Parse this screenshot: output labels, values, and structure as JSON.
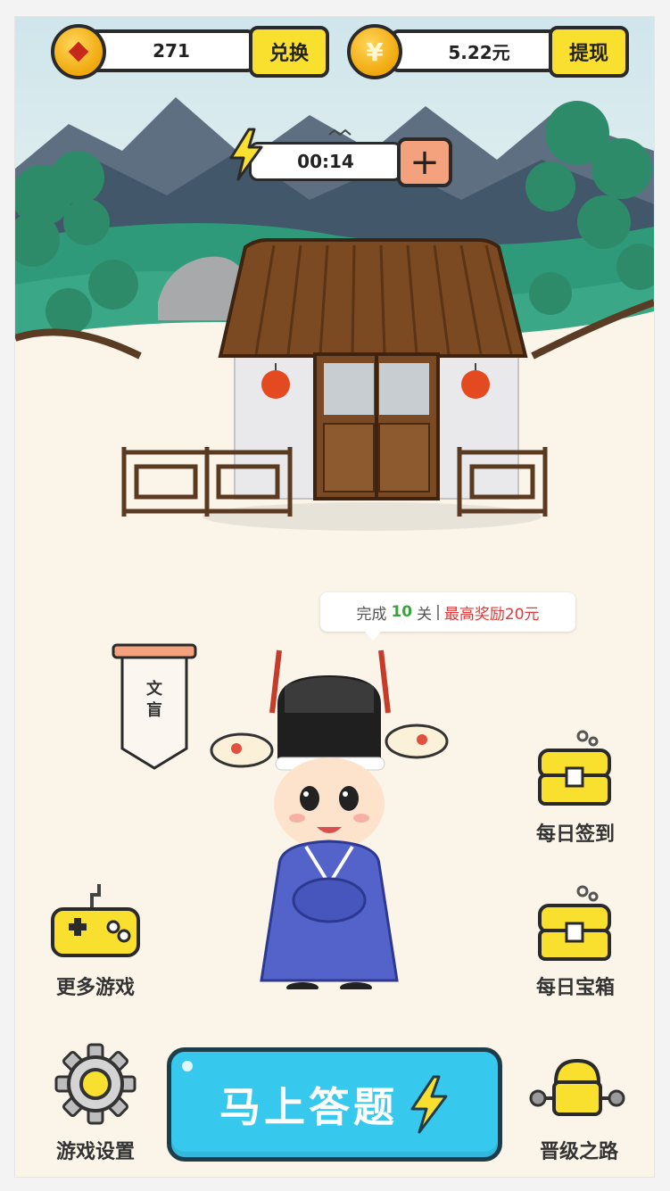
{
  "currency": {
    "coins": "271",
    "exchange_label": "兑换",
    "cash": "5.22元",
    "withdraw_label": "提现"
  },
  "energy": {
    "timer": "00:14",
    "add_label": "+"
  },
  "quest_bubble": {
    "prefix": "完成",
    "count": "10",
    "unit": "关",
    "separator": "|",
    "reward": "最高奖励20元"
  },
  "rank_banner": {
    "title": "文盲"
  },
  "side_menu": {
    "daily_checkin": "每日签到",
    "daily_chest": "每日宝箱",
    "more_games": "更多游戏",
    "game_settings": "游戏设置",
    "promotion_path": "晋级之路"
  },
  "main_action": {
    "label": "马上答题"
  },
  "colors": {
    "accent_yellow": "#f9df2e",
    "main_button": "#37c8ee",
    "reward_red": "#e03a3a",
    "count_green": "#3aa33a",
    "robe_blue": "#5463c9"
  }
}
